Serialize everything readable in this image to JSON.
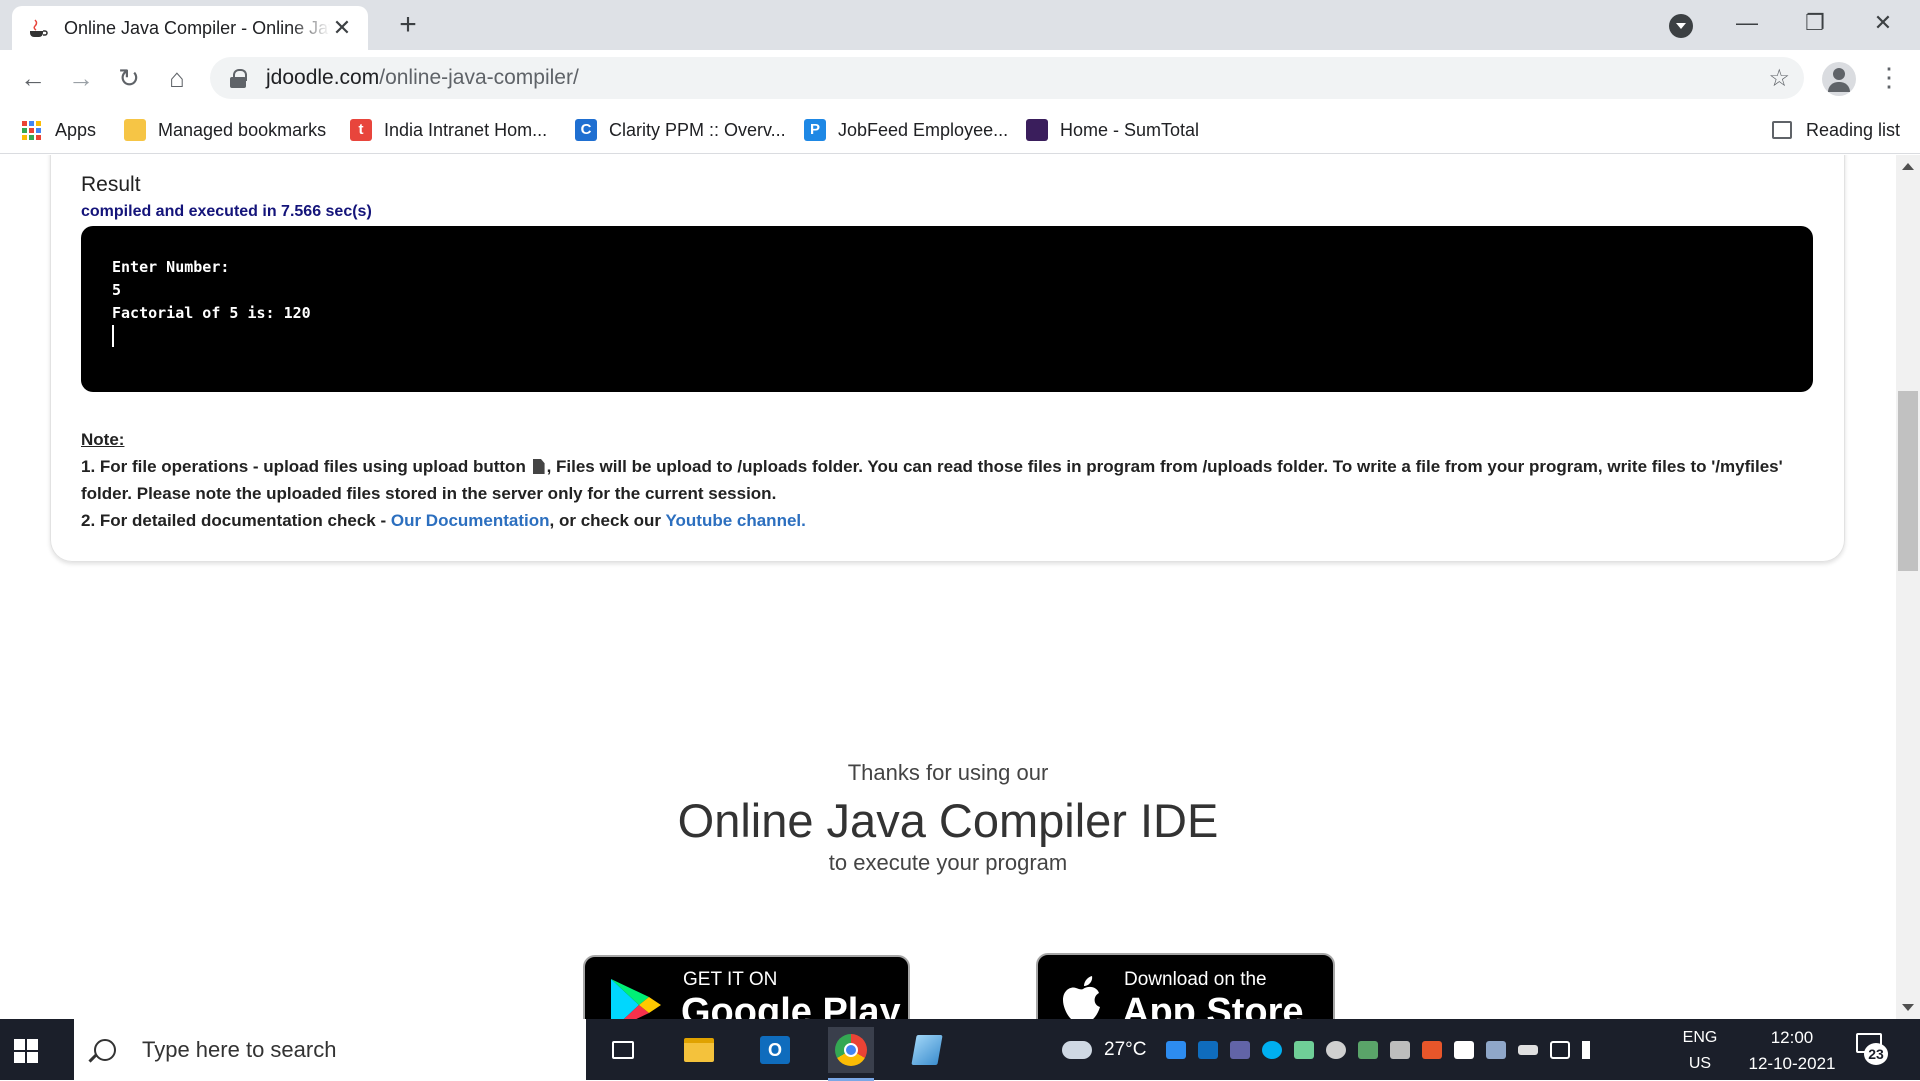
{
  "browser": {
    "tab_title": "Online Java Compiler - Online Java",
    "tab_close": "✕",
    "new_tab": "+",
    "url_host": "jdoodle.com",
    "url_path": "/online-java-compiler/",
    "window_controls": {
      "minimize": "—",
      "restore": "❐",
      "close": "✕"
    },
    "nav": {
      "back": "←",
      "forward": "→",
      "reload": "↻",
      "home": "⌂",
      "star": "☆",
      "menu": "⋮"
    },
    "bookmarks": [
      {
        "label": "Apps",
        "icon": "apps-grid-icon"
      },
      {
        "label": "Managed bookmarks",
        "icon": "folder-icon",
        "color": "#f6c545"
      },
      {
        "label": "India Intranet Hom...",
        "icon": "t",
        "color": "#e8453c"
      },
      {
        "label": "Clarity PPM :: Overv...",
        "icon": "C",
        "color": "#1f6fd1"
      },
      {
        "label": "JobFeed Employee...",
        "icon": "P",
        "color": "#1e88e5"
      },
      {
        "label": "Home - SumTotal",
        "icon": "sumtotal-icon",
        "color": "#3a1e5c"
      }
    ],
    "reading_list": "Reading list"
  },
  "result": {
    "label": "Result",
    "exec_time": "compiled and executed in 7.566 sec(s)",
    "console_lines": [
      "Enter Number:",
      "5",
      "Factorial of 5 is: 120"
    ]
  },
  "note": {
    "heading": "Note:",
    "line1_a": "1. For file operations - upload files using upload button",
    "line1_b": ", Files will be upload to /uploads folder. You can read those files in program from /uploads folder. To write a file from your program, write files to '/myfiles' folder. Please note the uploaded files stored in the server only for the current session.",
    "line2_a": "2. For detailed documentation check -",
    "doc_link": "Our Documentation",
    "line2_b": ", or check our",
    "yt_link": "Youtube channel."
  },
  "promo": {
    "line1": "Thanks for using our",
    "line2": "Online Java Compiler IDE",
    "line3": "to execute your program",
    "gplay_small": "GET IT ON",
    "gplay_big": "Google Play",
    "apple_small": "Download on the",
    "apple_big": "App Store"
  },
  "taskbar": {
    "search_placeholder": "Type here to search",
    "weather": "27°C",
    "lang_top": "ENG",
    "lang_bottom": "US",
    "time": "12:00",
    "date": "12-10-2021",
    "notification_count": "23"
  },
  "colors": {
    "accent_link": "#2c6fbf",
    "exec_time": "#14147a",
    "console_bg": "#000000"
  }
}
